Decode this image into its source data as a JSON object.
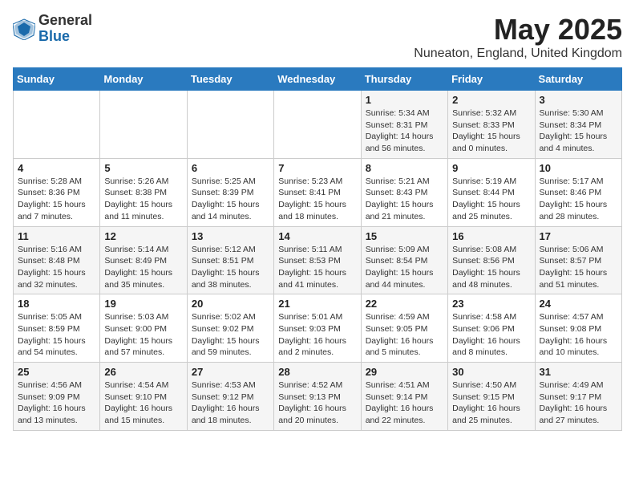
{
  "logo": {
    "general": "General",
    "blue": "Blue"
  },
  "title": "May 2025",
  "subtitle": "Nuneaton, England, United Kingdom",
  "days_of_week": [
    "Sunday",
    "Monday",
    "Tuesday",
    "Wednesday",
    "Thursday",
    "Friday",
    "Saturday"
  ],
  "weeks": [
    [
      {
        "day": "",
        "info": ""
      },
      {
        "day": "",
        "info": ""
      },
      {
        "day": "",
        "info": ""
      },
      {
        "day": "",
        "info": ""
      },
      {
        "day": "1",
        "info": "Sunrise: 5:34 AM\nSunset: 8:31 PM\nDaylight: 14 hours and 56 minutes."
      },
      {
        "day": "2",
        "info": "Sunrise: 5:32 AM\nSunset: 8:33 PM\nDaylight: 15 hours and 0 minutes."
      },
      {
        "day": "3",
        "info": "Sunrise: 5:30 AM\nSunset: 8:34 PM\nDaylight: 15 hours and 4 minutes."
      }
    ],
    [
      {
        "day": "4",
        "info": "Sunrise: 5:28 AM\nSunset: 8:36 PM\nDaylight: 15 hours and 7 minutes."
      },
      {
        "day": "5",
        "info": "Sunrise: 5:26 AM\nSunset: 8:38 PM\nDaylight: 15 hours and 11 minutes."
      },
      {
        "day": "6",
        "info": "Sunrise: 5:25 AM\nSunset: 8:39 PM\nDaylight: 15 hours and 14 minutes."
      },
      {
        "day": "7",
        "info": "Sunrise: 5:23 AM\nSunset: 8:41 PM\nDaylight: 15 hours and 18 minutes."
      },
      {
        "day": "8",
        "info": "Sunrise: 5:21 AM\nSunset: 8:43 PM\nDaylight: 15 hours and 21 minutes."
      },
      {
        "day": "9",
        "info": "Sunrise: 5:19 AM\nSunset: 8:44 PM\nDaylight: 15 hours and 25 minutes."
      },
      {
        "day": "10",
        "info": "Sunrise: 5:17 AM\nSunset: 8:46 PM\nDaylight: 15 hours and 28 minutes."
      }
    ],
    [
      {
        "day": "11",
        "info": "Sunrise: 5:16 AM\nSunset: 8:48 PM\nDaylight: 15 hours and 32 minutes."
      },
      {
        "day": "12",
        "info": "Sunrise: 5:14 AM\nSunset: 8:49 PM\nDaylight: 15 hours and 35 minutes."
      },
      {
        "day": "13",
        "info": "Sunrise: 5:12 AM\nSunset: 8:51 PM\nDaylight: 15 hours and 38 minutes."
      },
      {
        "day": "14",
        "info": "Sunrise: 5:11 AM\nSunset: 8:53 PM\nDaylight: 15 hours and 41 minutes."
      },
      {
        "day": "15",
        "info": "Sunrise: 5:09 AM\nSunset: 8:54 PM\nDaylight: 15 hours and 44 minutes."
      },
      {
        "day": "16",
        "info": "Sunrise: 5:08 AM\nSunset: 8:56 PM\nDaylight: 15 hours and 48 minutes."
      },
      {
        "day": "17",
        "info": "Sunrise: 5:06 AM\nSunset: 8:57 PM\nDaylight: 15 hours and 51 minutes."
      }
    ],
    [
      {
        "day": "18",
        "info": "Sunrise: 5:05 AM\nSunset: 8:59 PM\nDaylight: 15 hours and 54 minutes."
      },
      {
        "day": "19",
        "info": "Sunrise: 5:03 AM\nSunset: 9:00 PM\nDaylight: 15 hours and 57 minutes."
      },
      {
        "day": "20",
        "info": "Sunrise: 5:02 AM\nSunset: 9:02 PM\nDaylight: 15 hours and 59 minutes."
      },
      {
        "day": "21",
        "info": "Sunrise: 5:01 AM\nSunset: 9:03 PM\nDaylight: 16 hours and 2 minutes."
      },
      {
        "day": "22",
        "info": "Sunrise: 4:59 AM\nSunset: 9:05 PM\nDaylight: 16 hours and 5 minutes."
      },
      {
        "day": "23",
        "info": "Sunrise: 4:58 AM\nSunset: 9:06 PM\nDaylight: 16 hours and 8 minutes."
      },
      {
        "day": "24",
        "info": "Sunrise: 4:57 AM\nSunset: 9:08 PM\nDaylight: 16 hours and 10 minutes."
      }
    ],
    [
      {
        "day": "25",
        "info": "Sunrise: 4:56 AM\nSunset: 9:09 PM\nDaylight: 16 hours and 13 minutes."
      },
      {
        "day": "26",
        "info": "Sunrise: 4:54 AM\nSunset: 9:10 PM\nDaylight: 16 hours and 15 minutes."
      },
      {
        "day": "27",
        "info": "Sunrise: 4:53 AM\nSunset: 9:12 PM\nDaylight: 16 hours and 18 minutes."
      },
      {
        "day": "28",
        "info": "Sunrise: 4:52 AM\nSunset: 9:13 PM\nDaylight: 16 hours and 20 minutes."
      },
      {
        "day": "29",
        "info": "Sunrise: 4:51 AM\nSunset: 9:14 PM\nDaylight: 16 hours and 22 minutes."
      },
      {
        "day": "30",
        "info": "Sunrise: 4:50 AM\nSunset: 9:15 PM\nDaylight: 16 hours and 25 minutes."
      },
      {
        "day": "31",
        "info": "Sunrise: 4:49 AM\nSunset: 9:17 PM\nDaylight: 16 hours and 27 minutes."
      }
    ]
  ]
}
